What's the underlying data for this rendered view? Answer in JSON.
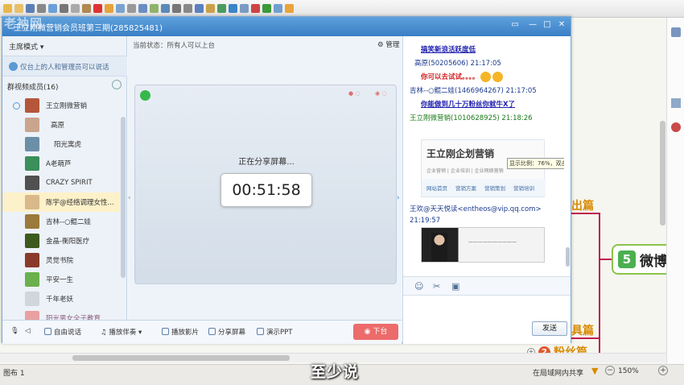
{
  "window": {
    "title": "王立刚微营销会员班第三期(285825481)",
    "watermark": "老衲网"
  },
  "left_panel": {
    "mode_label": "主席模式",
    "notice": "仅台上的人和管理员可以说话",
    "members_header": "群视频成员(16)",
    "members": [
      {
        "name": "王立刚微营销",
        "avatar_color": "#b5563b"
      },
      {
        "name": "高原",
        "avatar_color": "#c9a58d"
      },
      {
        "name": "阳光寓虎",
        "avatar_color": "#6c8fa8"
      },
      {
        "name": "A老萌芦",
        "avatar_color": "#3a8f5a"
      },
      {
        "name": "CRAZY SPIRIT",
        "avatar_color": "#505050"
      },
      {
        "name": "陈宇@经络调理女性...",
        "avatar_color": "#d9b98a"
      },
      {
        "name": "吉林--○鲲二娃",
        "avatar_color": "#9b7a3c"
      },
      {
        "name": "金晶-衡阳医疗",
        "avatar_color": "#3d5a1f"
      },
      {
        "name": "灵觉书院",
        "avatar_color": "#8a3a2a"
      },
      {
        "name": "平安一生",
        "avatar_color": "#6ab04c"
      },
      {
        "name": "千年老妖",
        "avatar_color": "#d0d6dc"
      },
      {
        "name": "阳光男女全子教育",
        "avatar_color": "#e8a0a0"
      }
    ]
  },
  "center_panel": {
    "status": "当前状态：所有人可以上台",
    "manage_label": "管理",
    "sharing_text": "正在分享屏幕...",
    "timer": "00:51:58"
  },
  "chat": {
    "messages": [
      {
        "text": "搞笑新浪活跃度低",
        "style": "blue-bold"
      },
      {
        "text": "高原(50205606)  21:17:05",
        "style": "meta"
      },
      {
        "text": "你可以去试试。。。。",
        "style": "red-bold"
      },
      {
        "text": "吉林--○鲲二娃(1466964267)  21:17:05",
        "style": "meta"
      },
      {
        "text": "你能做到几十万粉丝你就牛X了",
        "style": "blue-bold"
      },
      {
        "text": "王立刚微营销(1010628925)  21:18:26",
        "style": "meta-green"
      },
      {
        "text": "王欢@天天悦读<entheos@vip.qq.com>",
        "style": "meta"
      },
      {
        "text": "21:19:57",
        "style": "meta"
      }
    ],
    "card_title": "王立刚企划营销",
    "card_subtitle": "企业营销 | 企业培训 | 企业网络营销",
    "card_nav": [
      "网站首页",
      "营销方案",
      "营销策划",
      "营销培训"
    ],
    "zoom_tip": "显示比例：76%，双击查看原图",
    "send_label": "发送"
  },
  "bottom_bar": {
    "mic": "",
    "free_talk": "自由说话",
    "accompany": "播放伴奏",
    "play_video": "播放影片",
    "share_screen": "分享屏幕",
    "present_ppt": "演示PPT",
    "step_down": "下台"
  },
  "mindmap": {
    "node_wei_num": "5",
    "node_wei_label": "微博",
    "text_top": "出篇",
    "text_mid": "具篇",
    "node_fen_num": "2",
    "node_fen_label": "粉丝篇"
  },
  "status_bar": {
    "left": "图布 1",
    "share": "在局域网内共享",
    "zoom": "150%"
  },
  "subtitle": "至少说"
}
